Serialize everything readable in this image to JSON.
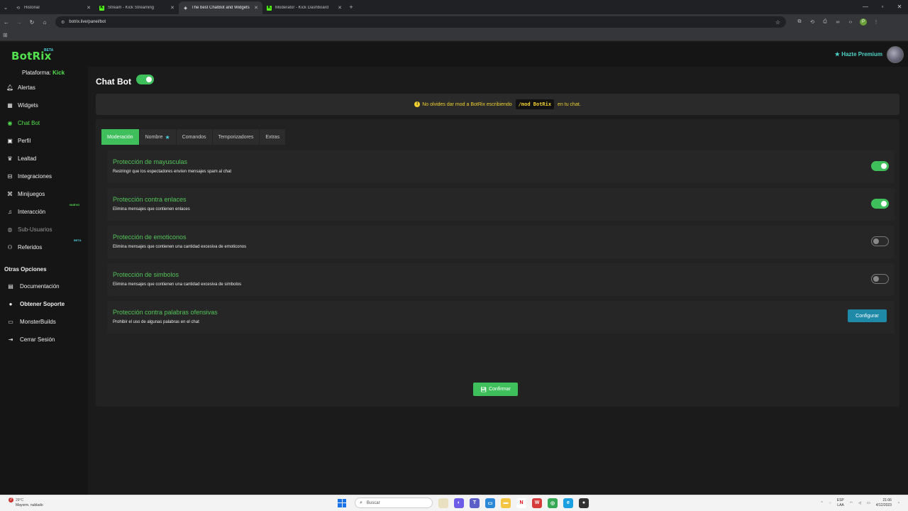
{
  "browser": {
    "tabs": [
      {
        "title": "Historial",
        "icon": "history-icon"
      },
      {
        "title": "Stream - Kick Streaming",
        "icon": "kick-icon"
      },
      {
        "title": "The best ChatBot and Widgets",
        "icon": "botrix-icon"
      },
      {
        "title": "Moderator - Kick Dashboard",
        "icon": "kick-icon"
      }
    ],
    "url": "botrix.live/panel/bot"
  },
  "header": {
    "logo": "BotRix",
    "logo_badge": "BETA",
    "premium_label": "Hazte Premium"
  },
  "sidebar": {
    "platform_label": "Plataforma:",
    "platform_value": "Kick",
    "items": [
      {
        "label": "Alertas",
        "icon": "bell-icon"
      },
      {
        "label": "Widgets",
        "icon": "widgets-icon"
      },
      {
        "label": "Chat Bot",
        "icon": "robot-icon"
      },
      {
        "label": "Perfil",
        "icon": "profile-icon"
      },
      {
        "label": "Lealtad",
        "icon": "trophy-icon"
      },
      {
        "label": "Integraciones",
        "icon": "integrations-icon"
      },
      {
        "label": "Minijuegos",
        "icon": "gamepad-icon"
      },
      {
        "label": "Interacción",
        "icon": "music-icon",
        "tag": "NUEVO"
      },
      {
        "label": "Sub-Usuarios",
        "icon": "users-icon"
      },
      {
        "label": "Referidos",
        "icon": "referrals-icon",
        "tag": "BETA"
      }
    ],
    "other_title": "Otras Opciones",
    "other_items": [
      {
        "label": "Documentación",
        "icon": "book-icon"
      },
      {
        "label": "Obtener Soporte",
        "icon": "support-icon"
      },
      {
        "label": "MonsterBuilds",
        "icon": "laptop-icon"
      },
      {
        "label": "Cerrar Sesión",
        "icon": "logout-icon"
      }
    ]
  },
  "main": {
    "title": "Chat Bot",
    "enabled": true,
    "notice": {
      "before": "No olvides dar mod a BotRix escribiendo",
      "command": "/mod BotRix",
      "after": "en tu chat."
    },
    "tabs": [
      "Moderación",
      "Nombre",
      "Comandos",
      "Temporizadores",
      "Extras"
    ],
    "settings": [
      {
        "title": "Protección de mayusculas",
        "desc": "Restringir que los espectadores envíen mensajes spam al chat",
        "enabled": true
      },
      {
        "title": "Protección contra enlaces",
        "desc": "Elimina mensajes que contienen enlaces",
        "enabled": true
      },
      {
        "title": "Protección de emoticonos",
        "desc": "Elimina mensajes que contienen una cantidad excesiva de emoticonos",
        "enabled": false
      },
      {
        "title": "Protección de simbolos",
        "desc": "Elimina mensajes que contienen una cantidad excesiva de simbolos",
        "enabled": false
      },
      {
        "title": "Protección contra palabras ofensivas",
        "desc": "Prohibir el uso de algunas palabras en el chat",
        "button": "Configurar"
      }
    ],
    "confirm_label": "Confirmar"
  },
  "taskbar": {
    "weather_temp": "29°C",
    "weather_desc": "Mayorm. nublado",
    "notification_count": "2",
    "search_placeholder": "Buscar",
    "lang_line1": "ESP",
    "lang_line2": "LAA",
    "time": "21:06",
    "date": "4/12/2023"
  },
  "colors": {
    "accent": "#3fbf5b",
    "setting_title": "#53c45a",
    "notice_text": "#f0d030",
    "configure_button": "#1e8aa8",
    "premium": "#4fd1c5"
  }
}
